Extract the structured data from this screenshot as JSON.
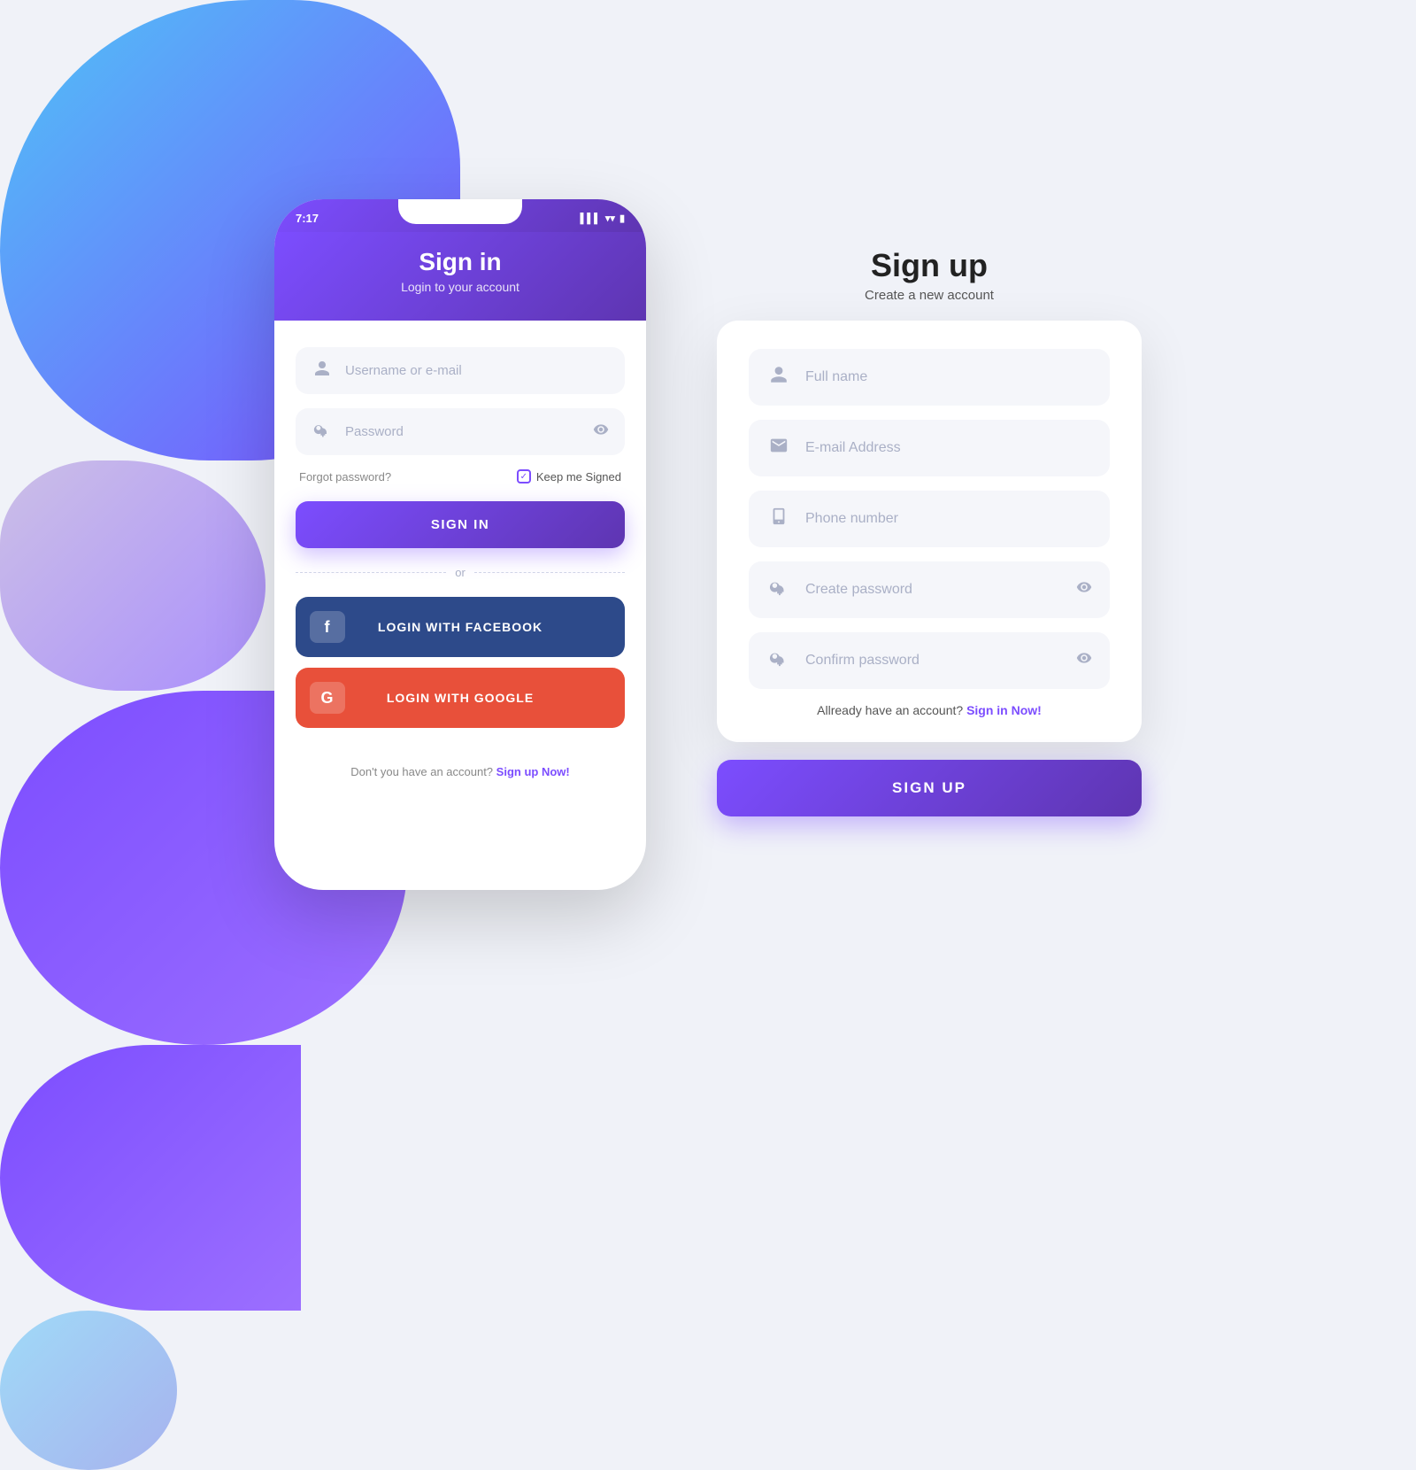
{
  "background": {
    "color": "#f0f2f8"
  },
  "phone": {
    "time": "7:17",
    "title": "Sign in",
    "subtitle": "Login to your account",
    "username_placeholder": "Username or e-mail",
    "password_placeholder": "Password",
    "forgot_label": "Forgot password?",
    "keep_signed_label": "Keep me Signed",
    "signin_button": "SIGN IN",
    "or_label": "or",
    "facebook_button": "LOGIN WITH FACEBOOK",
    "google_button": "LOGIN WITH GOOGLE",
    "footer_text": "Don't you have an account?",
    "footer_link": "Sign up Now!"
  },
  "signup": {
    "title": "Sign up",
    "subtitle": "Create a new account",
    "fullname_placeholder": "Full name",
    "email_placeholder": "E-mail Address",
    "phone_placeholder": "Phone number",
    "create_password_placeholder": "Create password",
    "confirm_password_placeholder": "Confirm password",
    "already_text": "Allready have an account?",
    "already_link": "Sign in Now!",
    "signup_button": "SIGN UP"
  }
}
